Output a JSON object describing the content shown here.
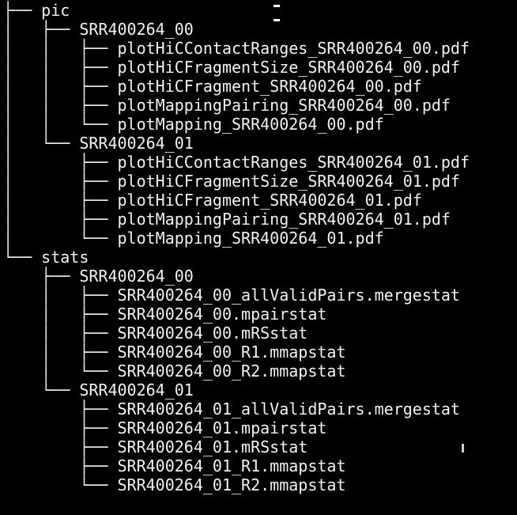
{
  "terminal": {
    "background": "#000000",
    "foreground": "#f2f2f2",
    "tree": [
      {
        "prefix": "├── ",
        "name": "pic",
        "kind": "dir"
      },
      {
        "prefix": "│   ├── ",
        "name": "SRR400264_00",
        "kind": "dir"
      },
      {
        "prefix": "│   │   ├── ",
        "name": "plotHiCContactRanges_SRR400264_00.pdf",
        "kind": "file"
      },
      {
        "prefix": "│   │   ├── ",
        "name": "plotHiCFragmentSize_SRR400264_00.pdf",
        "kind": "file"
      },
      {
        "prefix": "│   │   ├── ",
        "name": "plotHiCFragment_SRR400264_00.pdf",
        "kind": "file"
      },
      {
        "prefix": "│   │   ├── ",
        "name": "plotMappingPairing_SRR400264_00.pdf",
        "kind": "file"
      },
      {
        "prefix": "│   │   └── ",
        "name": "plotMapping_SRR400264_00.pdf",
        "kind": "file"
      },
      {
        "prefix": "│   └── ",
        "name": "SRR400264_01",
        "kind": "dir"
      },
      {
        "prefix": "│       ├── ",
        "name": "plotHiCContactRanges_SRR400264_01.pdf",
        "kind": "file"
      },
      {
        "prefix": "│       ├── ",
        "name": "plotHiCFragmentSize_SRR400264_01.pdf",
        "kind": "file"
      },
      {
        "prefix": "│       ├── ",
        "name": "plotHiCFragment_SRR400264_01.pdf",
        "kind": "file"
      },
      {
        "prefix": "│       ├── ",
        "name": "plotMappingPairing_SRR400264_01.pdf",
        "kind": "file"
      },
      {
        "prefix": "│       └── ",
        "name": "plotMapping_SRR400264_01.pdf",
        "kind": "file"
      },
      {
        "prefix": "└── ",
        "name": "stats",
        "kind": "dir"
      },
      {
        "prefix": "    ├── ",
        "name": "SRR400264_00",
        "kind": "dir"
      },
      {
        "prefix": "    │   ├── ",
        "name": "SRR400264_00_allValidPairs.mergestat",
        "kind": "file"
      },
      {
        "prefix": "    │   ├── ",
        "name": "SRR400264_00.mpairstat",
        "kind": "file"
      },
      {
        "prefix": "    │   ├── ",
        "name": "SRR400264_00.mRSstat",
        "kind": "file"
      },
      {
        "prefix": "    │   ├── ",
        "name": "SRR400264_00_R1.mmapstat",
        "kind": "file"
      },
      {
        "prefix": "    │   └── ",
        "name": "SRR400264_00_R2.mmapstat",
        "kind": "file"
      },
      {
        "prefix": "    └── ",
        "name": "SRR400264_01",
        "kind": "dir"
      },
      {
        "prefix": "        ├── ",
        "name": "SRR400264_01_allValidPairs.mergestat",
        "kind": "file"
      },
      {
        "prefix": "        ├── ",
        "name": "SRR400264_01.mpairstat",
        "kind": "file"
      },
      {
        "prefix": "        ├── ",
        "name": "SRR400264_01.mRSstat",
        "kind": "file"
      },
      {
        "prefix": "        ├── ",
        "name": "SRR400264_01_R1.mmapstat",
        "kind": "file"
      },
      {
        "prefix": "        └── ",
        "name": "SRR400264_01_R2.mmapstat",
        "kind": "file"
      }
    ]
  }
}
